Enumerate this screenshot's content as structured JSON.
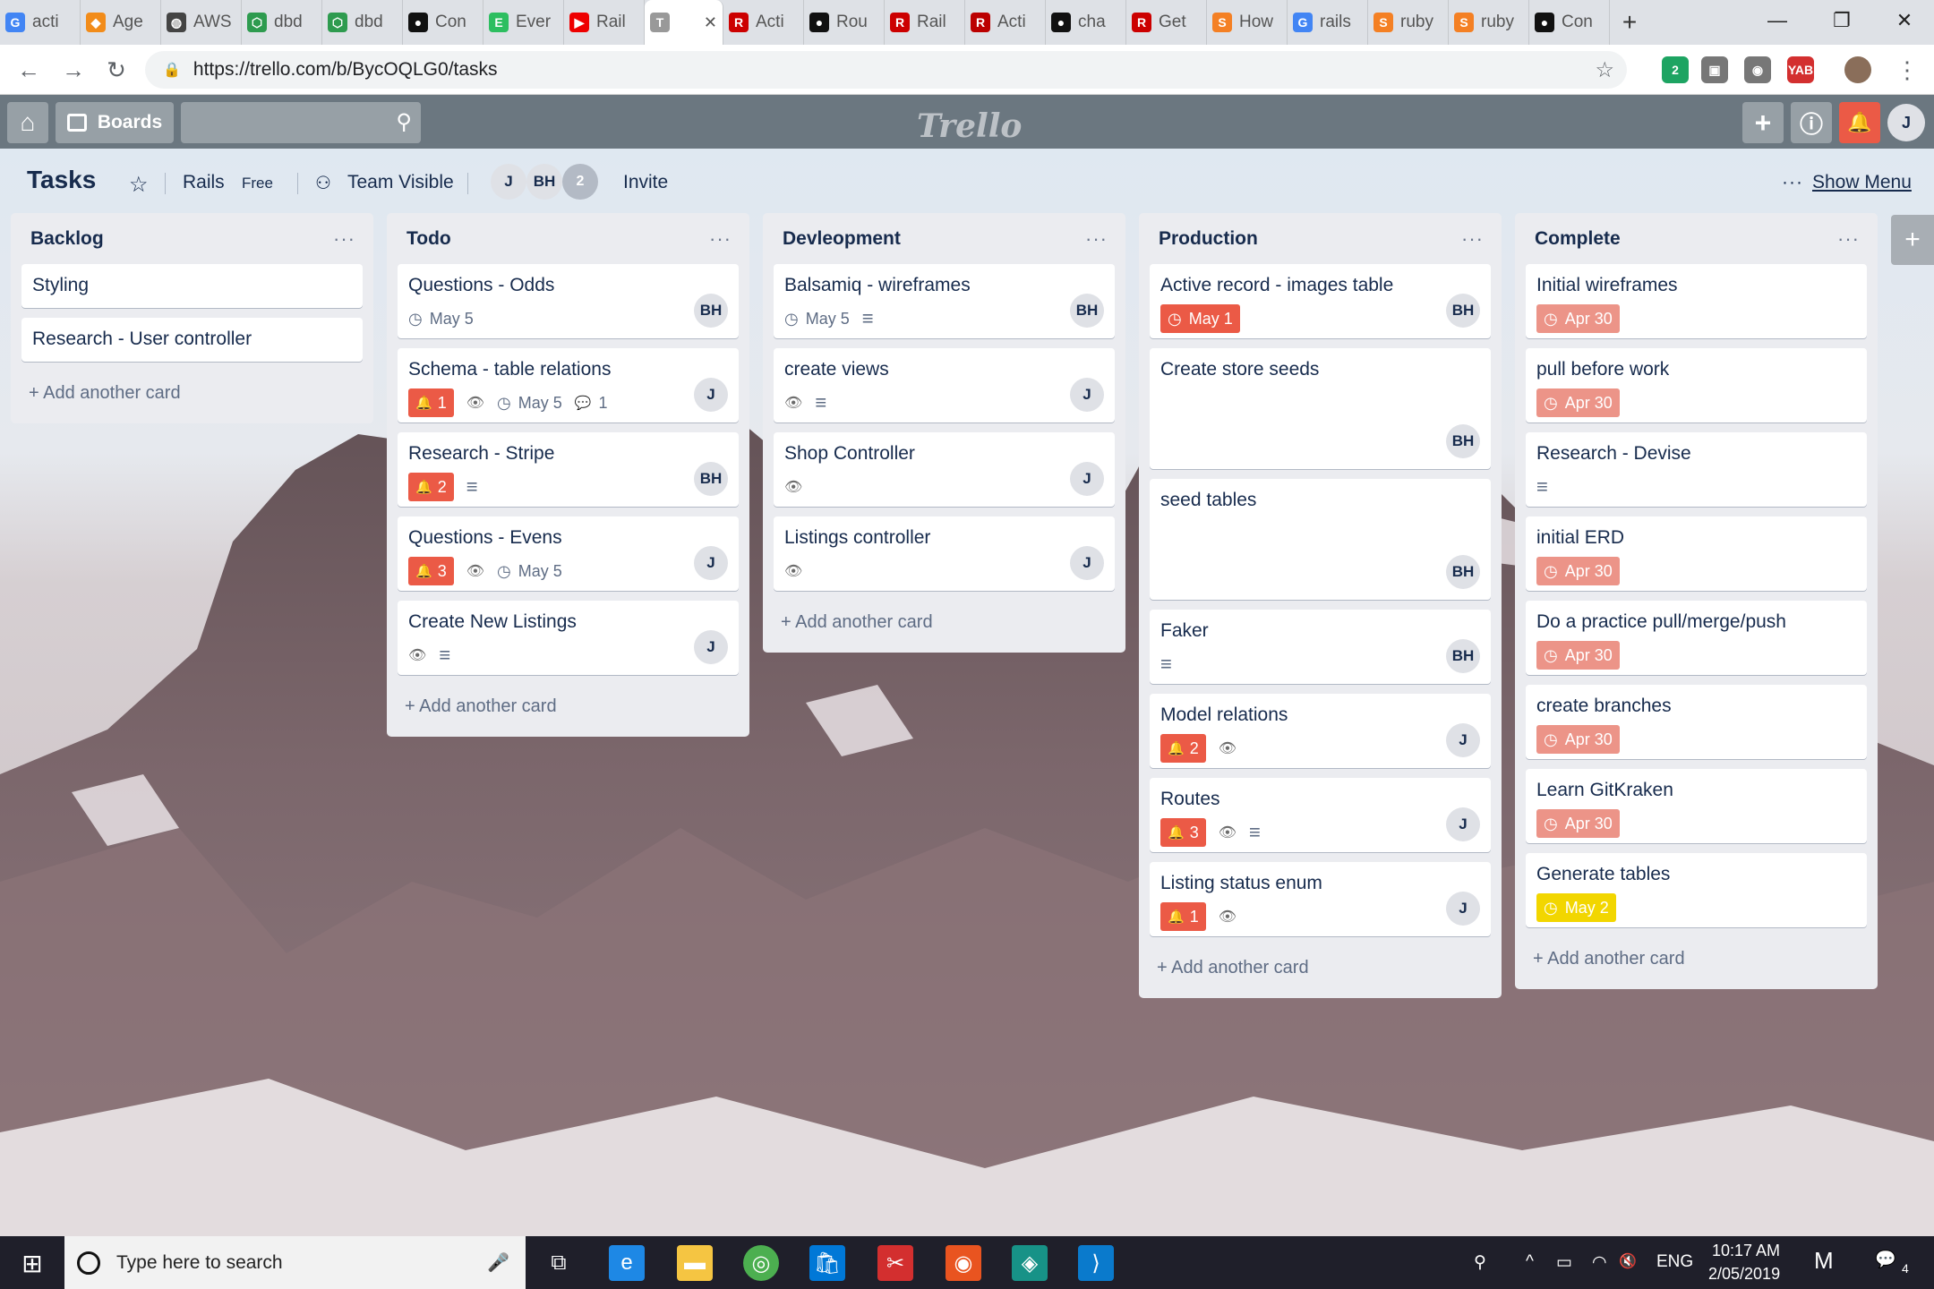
{
  "browser": {
    "tabs": [
      {
        "label": "acti",
        "fav": "G",
        "color": "#4285f4"
      },
      {
        "label": "Age",
        "fav": "◆",
        "color": "#f28c1a"
      },
      {
        "label": "AWS",
        "fav": "◍",
        "color": "#444"
      },
      {
        "label": "dbd",
        "fav": "⬡",
        "color": "#2e9b4f"
      },
      {
        "label": "dbd",
        "fav": "⬡",
        "color": "#2e9b4f"
      },
      {
        "label": "Con",
        "fav": "●",
        "color": "#111"
      },
      {
        "label": "Ever",
        "fav": "E",
        "color": "#2dbe60"
      },
      {
        "label": "Rail",
        "fav": "▶",
        "color": "#e00"
      },
      {
        "label": "",
        "fav": "T",
        "color": "#999",
        "active": true
      },
      {
        "label": "Acti",
        "fav": "R",
        "color": "#c00"
      },
      {
        "label": "Rou",
        "fav": "●",
        "color": "#111"
      },
      {
        "label": "Rail",
        "fav": "R",
        "color": "#c00"
      },
      {
        "label": "Acti",
        "fav": "R",
        "color": "#b00"
      },
      {
        "label": "cha",
        "fav": "●",
        "color": "#111"
      },
      {
        "label": "Get",
        "fav": "R",
        "color": "#c00"
      },
      {
        "label": "How",
        "fav": "S",
        "color": "#f48024"
      },
      {
        "label": "rails",
        "fav": "G",
        "color": "#4285f4"
      },
      {
        "label": "ruby",
        "fav": "S",
        "color": "#f48024"
      },
      {
        "label": "ruby",
        "fav": "S",
        "color": "#f48024"
      },
      {
        "label": "Con",
        "fav": "●",
        "color": "#111"
      }
    ],
    "new_tab": "+",
    "minimize": "—",
    "restore": "❐",
    "close": "✕",
    "back": "←",
    "forward": "→",
    "reload": "↻",
    "url": "https://trello.com/b/BycOQLG0/tasks",
    "lock": "🔒",
    "star": "☆",
    "extensions": [
      {
        "label": "2",
        "color": "#1da462"
      },
      {
        "label": "▣",
        "color": "#777"
      },
      {
        "label": "◉",
        "color": "#777"
      },
      {
        "label": "YAB",
        "color": "#d32f2f"
      },
      {
        "label": "",
        "color": "#8a6e5a"
      }
    ],
    "menu": "⋮"
  },
  "trello_header": {
    "home_icon": "⌂",
    "boards_label": "Boards",
    "search_icon": "⚲",
    "logo": "Trello",
    "plus": "+",
    "info": "ⓘ",
    "bell": "🔔",
    "user_initial": "J"
  },
  "board": {
    "title": "Tasks",
    "star": "☆",
    "team": "Rails",
    "plan": "Free",
    "visibility_icon": "⚇",
    "visibility": "Team Visible",
    "members": [
      "J",
      "BH"
    ],
    "member_count": "2",
    "invite": "Invite",
    "menu_dots": "···",
    "show_menu": "Show Menu"
  },
  "lists": [
    {
      "name": "Backlog",
      "cards": [
        {
          "title": "Styling"
        },
        {
          "title": "Research - User controller"
        }
      ],
      "add": "+ Add another card"
    },
    {
      "name": "Todo",
      "cards": [
        {
          "title": "Questions - Odds",
          "due": "May 5",
          "member": "BH"
        },
        {
          "title": "Schema - table relations",
          "bell": "1",
          "watch": true,
          "due": "May 5",
          "comments": "1",
          "member": "J"
        },
        {
          "title": "Research - Stripe",
          "bell": "2",
          "desc": true,
          "member": "BH"
        },
        {
          "title": "Questions - Evens",
          "bell": "3",
          "watch": true,
          "due": "May 5",
          "member": "J"
        },
        {
          "title": "Create New Listings",
          "watch": true,
          "desc": true,
          "member": "J"
        }
      ],
      "add": "+ Add another card"
    },
    {
      "name": "Devleopment",
      "cards": [
        {
          "title": "Balsamiq - wireframes",
          "due": "May 5",
          "desc": true,
          "member": "BH"
        },
        {
          "title": "create views",
          "watch": true,
          "desc": true,
          "member": "J"
        },
        {
          "title": "Shop Controller",
          "watch": true,
          "member": "J"
        },
        {
          "title": "Listings controller",
          "watch": true,
          "member": "J"
        }
      ],
      "add": "+ Add another card"
    },
    {
      "name": "Production",
      "cards": [
        {
          "title": "Active record - images table",
          "due_label": "May 1",
          "due_color": "red",
          "member": "BH"
        },
        {
          "title": "Create store seeds",
          "member": "BH",
          "tall": true
        },
        {
          "title": "seed tables",
          "member": "BH",
          "tall": true
        },
        {
          "title": "Faker",
          "desc": true,
          "member": "BH"
        },
        {
          "title": "Model relations",
          "bell": "2",
          "watch": true,
          "member": "J"
        },
        {
          "title": "Routes",
          "bell": "3",
          "watch": true,
          "desc": true,
          "member": "J"
        },
        {
          "title": "Listing status enum",
          "bell": "1",
          "watch": true,
          "member": "J"
        }
      ],
      "add": "+ Add another card"
    },
    {
      "name": "Complete",
      "cards": [
        {
          "title": "Initial wireframes",
          "due_label": "Apr 30",
          "due_color": "pink"
        },
        {
          "title": "pull before work",
          "due_label": "Apr 30",
          "due_color": "pink"
        },
        {
          "title": "Research - Devise",
          "desc": true
        },
        {
          "title": "initial ERD",
          "due_label": "Apr 30",
          "due_color": "pink"
        },
        {
          "title": "Do a practice pull/merge/push",
          "due_label": "Apr 30",
          "due_color": "pink"
        },
        {
          "title": "create branches",
          "due_label": "Apr 30",
          "due_color": "pink"
        },
        {
          "title": "Learn GitKraken",
          "due_label": "Apr 30",
          "due_color": "pink"
        },
        {
          "title": "Generate tables",
          "due_label": "May 2",
          "due_color": "yellow"
        }
      ],
      "add": "+ Add another card"
    }
  ],
  "add_list": "+",
  "taskbar": {
    "start": "⊞",
    "search_placeholder": "Type here to search",
    "mic": "🎤",
    "task_view": "⧉",
    "apps": [
      {
        "glyph": "e",
        "color": "#1e88e5"
      },
      {
        "glyph": "▬",
        "color": "#f5c542"
      },
      {
        "glyph": "◎",
        "color": "#4caf50"
      },
      {
        "glyph": "🛍",
        "color": "#0078d7"
      },
      {
        "glyph": "✂",
        "color": "#d32f2f"
      },
      {
        "glyph": "◉",
        "color": "#e95420"
      },
      {
        "glyph": "◈",
        "color": "#179287"
      },
      {
        "glyph": "⟩",
        "color": "#0a7acc"
      }
    ],
    "people": "⚲",
    "tray_up": "^",
    "battery": "▭",
    "wifi": "◠",
    "volume": "🔇",
    "lang": "ENG",
    "time": "10:17 AM",
    "date": "2/05/2019",
    "notif": "💬",
    "notif_count": "4"
  },
  "colors": {
    "bell": "#eb5a46",
    "due_red": "#eb5a46",
    "due_pink": "#ec9488",
    "due_yellow": "#f2d600",
    "header": "#6b7780",
    "list_bg": "#ebecf0"
  }
}
